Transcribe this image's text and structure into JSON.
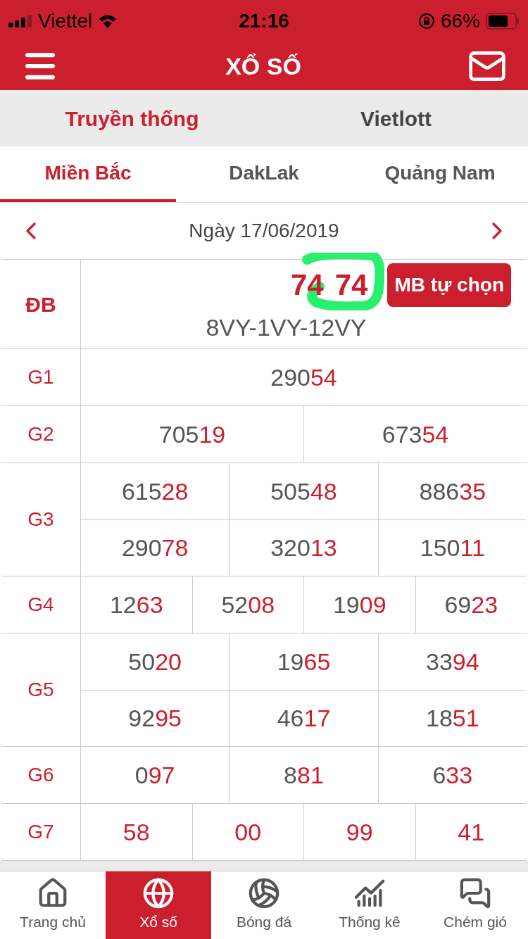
{
  "status_bar": {
    "carrier": "Viettel",
    "time": "21:16",
    "battery": "66%"
  },
  "header": {
    "title": "XỔ SỐ"
  },
  "category_tabs": [
    {
      "label": "Truyền thống",
      "selected": true
    },
    {
      "label": "Vietlott",
      "selected": false
    }
  ],
  "region_tabs": [
    {
      "label": "Miền Bắc",
      "selected": true
    },
    {
      "label": "DakLak",
      "selected": false
    },
    {
      "label": "Quảng Nam",
      "selected": false
    }
  ],
  "date": "Ngày 17/06/2019",
  "special_prize": {
    "label": "ĐB",
    "parts": [
      "74",
      "74"
    ],
    "button": "MB tự chọn",
    "codes": "8VY-1VY-12VY"
  },
  "prizes": [
    {
      "label": "G1",
      "rows": [
        [
          {
            "head": "290",
            "tail": "54"
          }
        ]
      ]
    },
    {
      "label": "G2",
      "rows": [
        [
          {
            "head": "705",
            "tail": "19"
          },
          {
            "head": "673",
            "tail": "54"
          }
        ]
      ]
    },
    {
      "label": "G3",
      "rows": [
        [
          {
            "head": "615",
            "tail": "28"
          },
          {
            "head": "505",
            "tail": "48"
          },
          {
            "head": "886",
            "tail": "35"
          }
        ],
        [
          {
            "head": "290",
            "tail": "78"
          },
          {
            "head": "320",
            "tail": "13"
          },
          {
            "head": "150",
            "tail": "11"
          }
        ]
      ]
    },
    {
      "label": "G4",
      "rows": [
        [
          {
            "head": "12",
            "tail": "63"
          },
          {
            "head": "52",
            "tail": "08"
          },
          {
            "head": "19",
            "tail": "09"
          },
          {
            "head": "69",
            "tail": "23"
          }
        ]
      ]
    },
    {
      "label": "G5",
      "rows": [
        [
          {
            "head": "50",
            "tail": "20"
          },
          {
            "head": "19",
            "tail": "65"
          },
          {
            "head": "33",
            "tail": "94"
          }
        ],
        [
          {
            "head": "92",
            "tail": "95"
          },
          {
            "head": "46",
            "tail": "17"
          },
          {
            "head": "18",
            "tail": "51"
          }
        ]
      ]
    },
    {
      "label": "G6",
      "rows": [
        [
          {
            "head": "0",
            "tail": "97"
          },
          {
            "head": "8",
            "tail": "81"
          },
          {
            "head": "6",
            "tail": "33"
          }
        ]
      ]
    },
    {
      "label": "G7",
      "rows": [
        [
          {
            "tail": "58"
          },
          {
            "tail": "00"
          },
          {
            "tail": "99"
          },
          {
            "tail": "41"
          }
        ]
      ]
    }
  ],
  "bottom_nav": [
    {
      "label": "Trang chủ",
      "kind": "home",
      "selected": false
    },
    {
      "label": "Xổ số",
      "kind": "globe",
      "selected": true
    },
    {
      "label": "Bóng đá",
      "kind": "ball",
      "selected": false
    },
    {
      "label": "Thống kê",
      "kind": "chart",
      "selected": false
    },
    {
      "label": "Chém gió",
      "kind": "chat",
      "selected": false
    }
  ]
}
